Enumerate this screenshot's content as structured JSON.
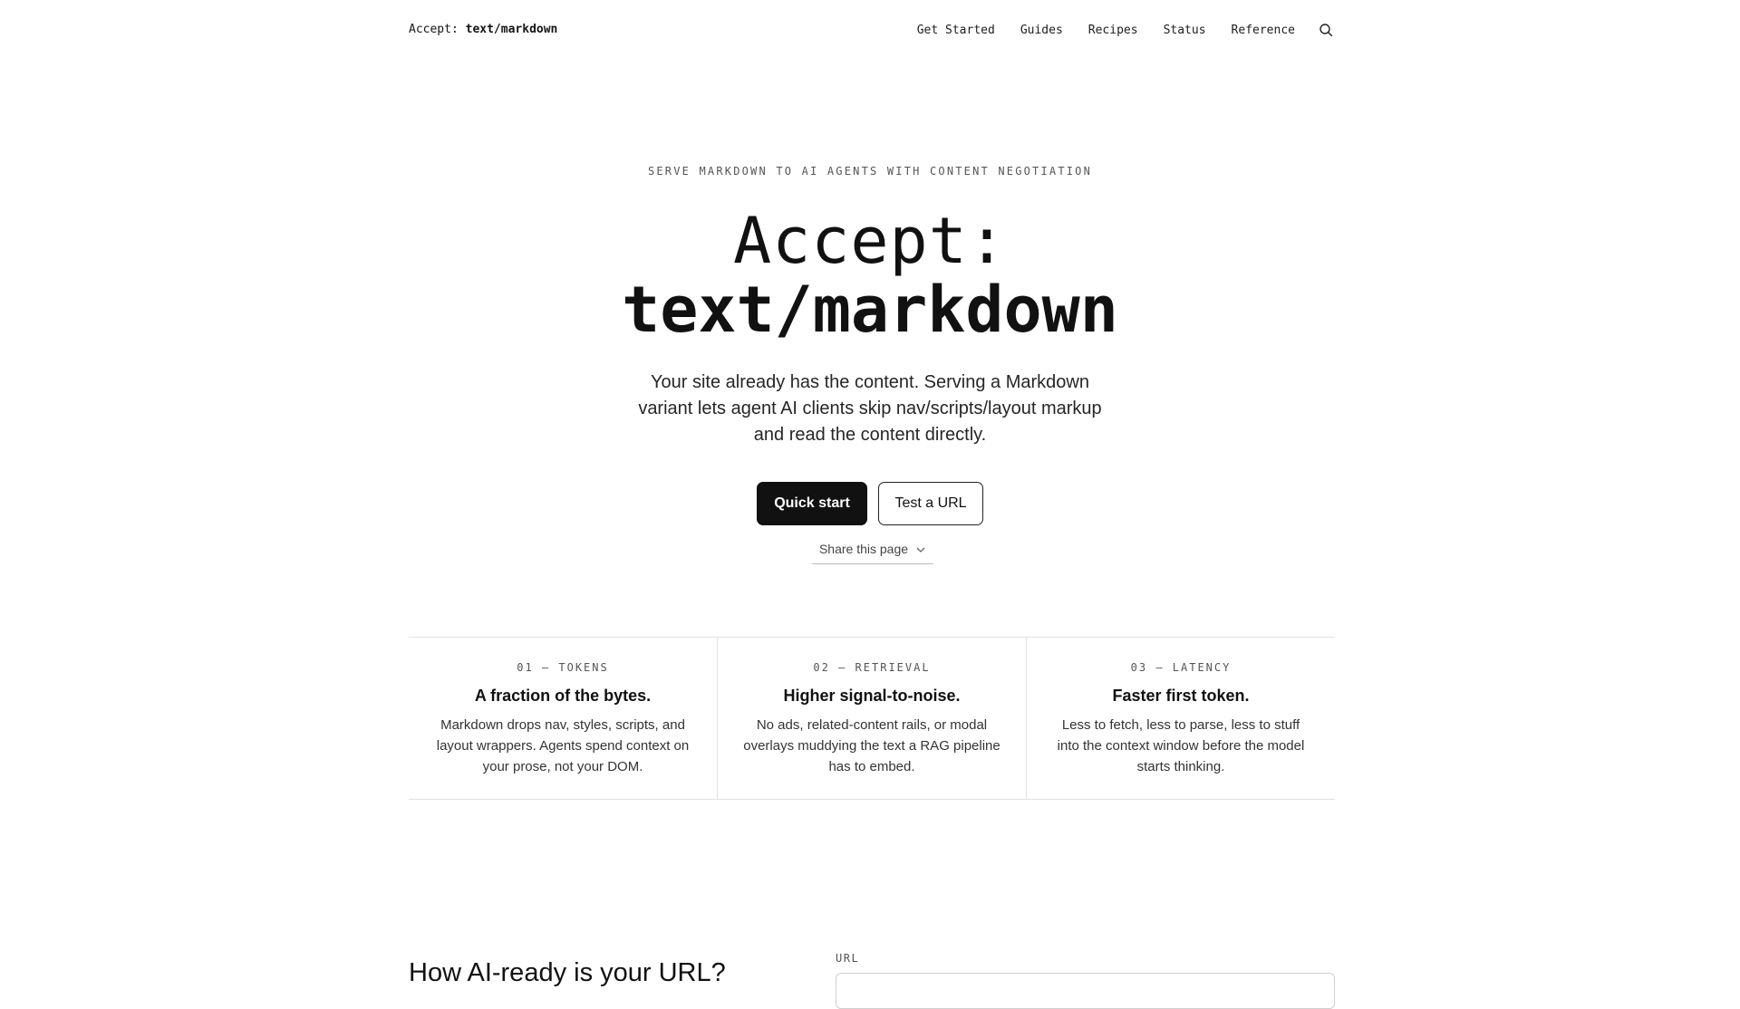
{
  "header": {
    "brand_part1": "Accept: ",
    "brand_part2": "text/markdown",
    "nav": [
      {
        "label": "Get Started"
      },
      {
        "label": "Guides"
      },
      {
        "label": "Recipes"
      },
      {
        "label": "Status"
      },
      {
        "label": "Reference"
      }
    ],
    "search_icon": "search-icon"
  },
  "hero": {
    "eyebrow": "SERVE MARKDOWN TO AI AGENTS WITH CONTENT NEGOTIATION",
    "title_line1": "Accept:",
    "title_line2": "text/markdown",
    "subtitle": "Your site already has the content. Serving a Markdown variant lets agent AI clients skip nav/scripts/layout markup and read the content directly.",
    "primary_cta": "Quick start",
    "secondary_cta": "Test a URL",
    "share_label": "Share this page",
    "share_icon": "chevron-down-icon"
  },
  "features": [
    {
      "label": "01 — TOKENS",
      "title": "A fraction of the bytes.",
      "desc": "Markdown drops nav, styles, scripts, and layout wrappers. Agents spend context on your prose, not your DOM."
    },
    {
      "label": "02 — RETRIEVAL",
      "title": "Higher signal-to-noise.",
      "desc": "No ads, related-content rails, or modal overlays muddying the text a RAG pipeline has to embed."
    },
    {
      "label": "03 — LATENCY",
      "title": "Faster first token.",
      "desc": "Less to fetch, less to parse, less to stuff into the context window before the model starts thinking."
    }
  ],
  "checker": {
    "title": "How AI-ready is your URL?",
    "url_label": "URL",
    "url_value": ""
  },
  "colors": {
    "text": "#151515",
    "primary_button_bg": "#111111",
    "border": "#e2e2e2"
  }
}
